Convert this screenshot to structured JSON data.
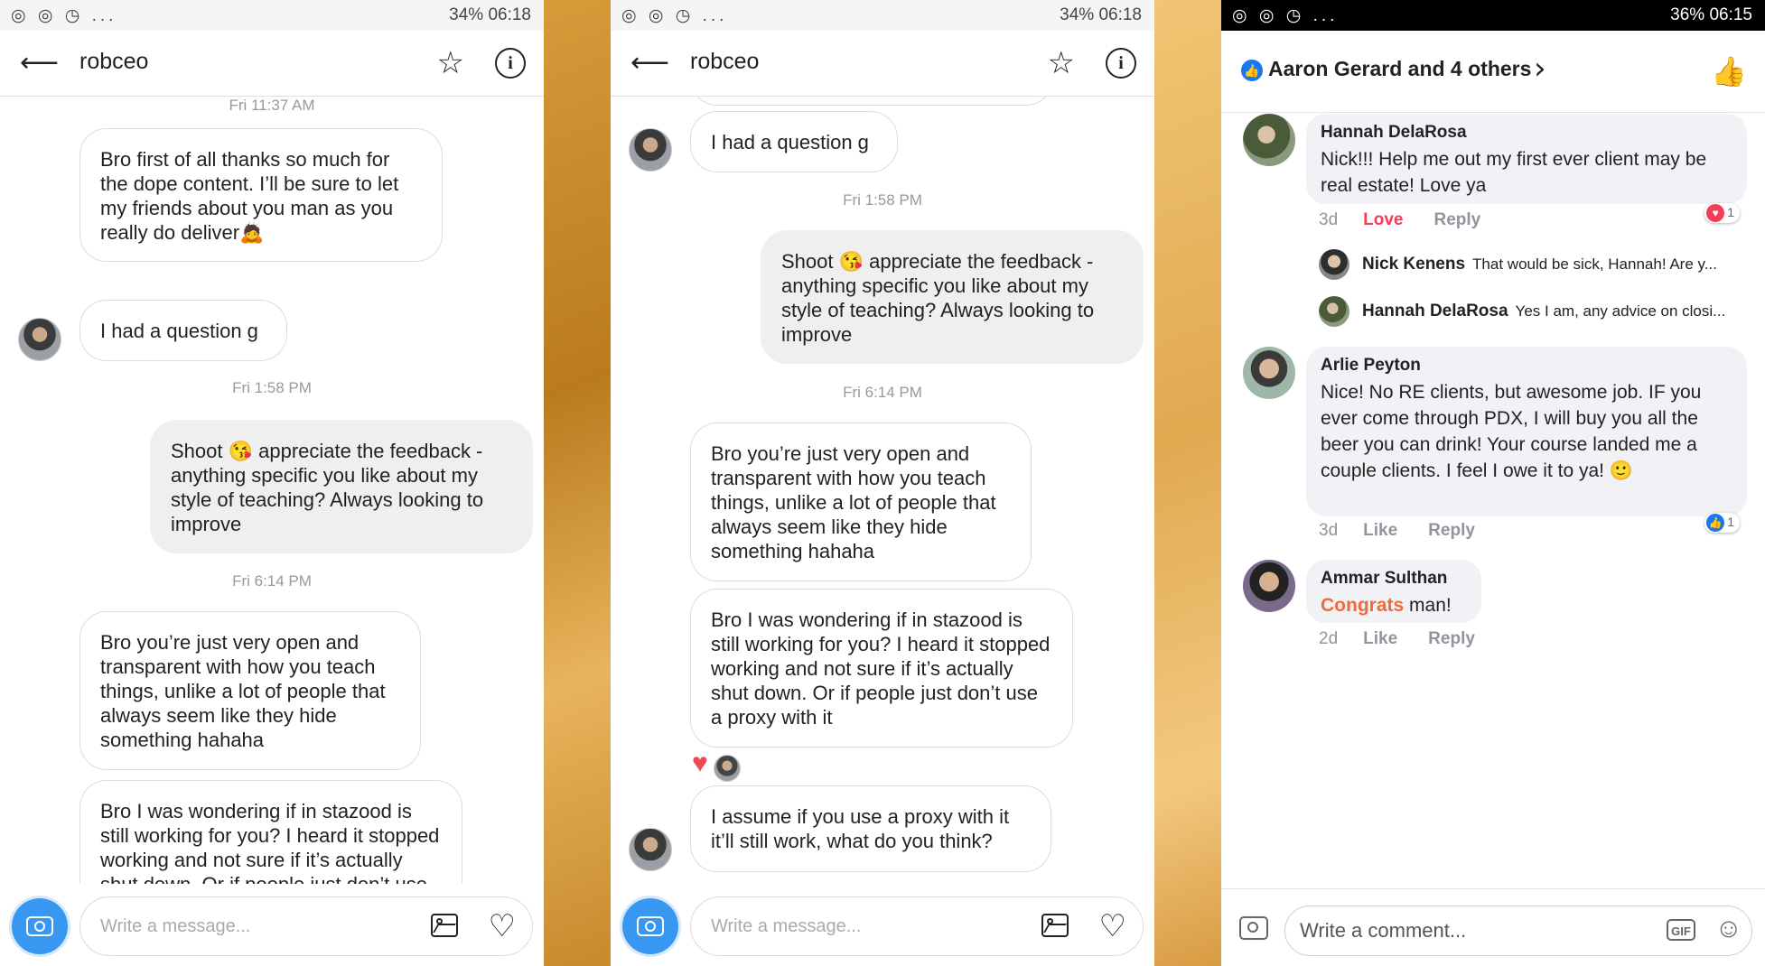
{
  "status_left_icons": "◎ ◎ ◷ ...",
  "panel1": {
    "status_right": "34%  06:18",
    "username": "robceo",
    "timestamps": [
      "Fri 11:37 AM",
      "Fri 1:58 PM",
      "Fri 6:14 PM"
    ],
    "messages": [
      "Bro first of all thanks so much for the dope content. I’ll be sure to let my friends about you man as you really do deliver🙇",
      "I had a question g",
      "Shoot 😘 appreciate the feedback - anything specific you like about my style of teaching? Always looking to improve",
      "Bro you’re just very open and transparent with how you teach things, unlike a lot of people that always seem like they hide something hahaha",
      "Bro I was wondering if in stazood is still working for you? I heard it stopped working and not sure if it’s actually shut down. Or if people just don’t use a proxy with it"
    ],
    "input_placeholder": "Write a message..."
  },
  "panel2": {
    "status_right": "34%  06:18",
    "username": "robceo",
    "timestamps": [
      "Fri 1:58 PM",
      "Fri 6:14 PM"
    ],
    "messages": [
      "I had a question g",
      "Shoot 😘 appreciate the feedback - anything specific you like about my style of teaching? Always looking to improve",
      "Bro you’re just very open and transparent with how you teach things, unlike a lot of people that always seem like they hide something hahaha",
      "Bro I was wondering if in stazood is still working for you? I heard it stopped working and not sure if it’s actually shut down. Or if people just don’t use a proxy with it",
      "I assume if you use a proxy with it it’ll still work, what do you think?"
    ],
    "input_placeholder": "Write a message..."
  },
  "panel3": {
    "status_right": "36%  06:15",
    "header_title": "Aaron Gerard and 4 others",
    "comments": [
      {
        "name": "Hannah DelaRosa",
        "text": "Nick!!! Help me out my first ever client may be real estate! Love ya",
        "time": "3d",
        "action": "Love",
        "reply": "Reply",
        "reaction_count": "1",
        "replies": [
          {
            "name": "Nick Kenens",
            "text": "That would be sick, Hannah! Are y..."
          },
          {
            "name": "Hannah DelaRosa",
            "text": "Yes I am, any advice on closi..."
          }
        ]
      },
      {
        "name": "Arlie Peyton",
        "text": "Nice! No RE clients, but awesome job. IF you ever come through PDX, I will buy you all the beer you can drink! Your course landed me a couple clients. I feel I owe it to ya! 🙂",
        "time": "3d",
        "action": "Like",
        "reply": "Reply",
        "reaction_count": "1"
      },
      {
        "name": "Ammar Sulthan",
        "text_highlight": "Congrats",
        "text_rest": " man!",
        "time": "2d",
        "action": "Like",
        "reply": "Reply"
      }
    ],
    "input_placeholder": "Write a comment..."
  },
  "icons": {
    "back": "arrow-left-icon",
    "star": "star-icon",
    "info": "info-icon",
    "camera": "camera-icon",
    "image": "image-icon",
    "heart": "heart-icon",
    "like": "thumbs-up-icon",
    "gif": "gif-icon",
    "emoji": "smiley-icon"
  },
  "colors": {
    "ig_blue": "#3897f0",
    "fb_blue": "#1877f2",
    "love_red": "#f33e58",
    "congrats_orange": "#f06b3b"
  }
}
